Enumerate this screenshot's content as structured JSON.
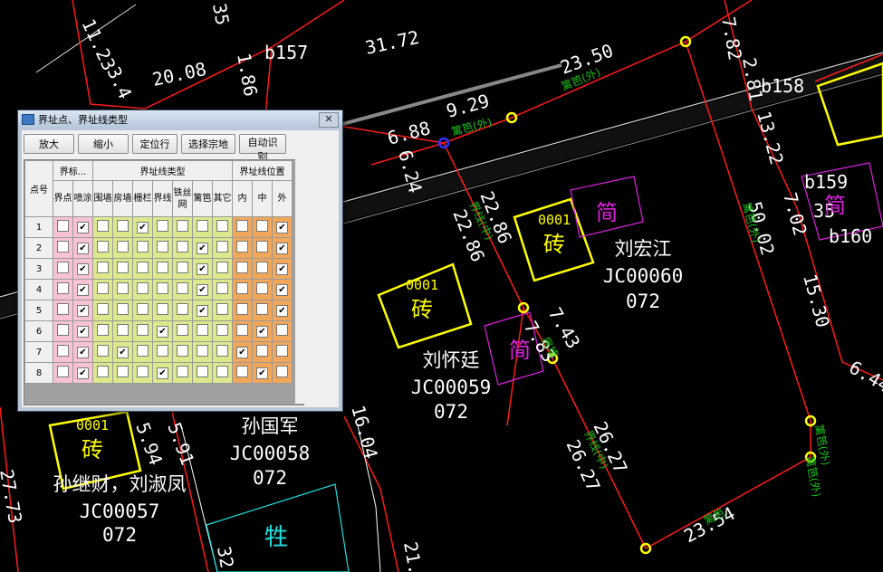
{
  "dialog": {
    "title": "界址点、界址线类型",
    "close_glyph": "✕",
    "toolbar": {
      "zoom_in": "放大",
      "zoom_out": "缩小",
      "locate_row": "定位行",
      "select_parcel": "选择宗地",
      "auto_identify": "自动识别"
    },
    "grid": {
      "point_no_header": "点号",
      "group_marker": "界标...",
      "group_line_type": "界址线类型",
      "group_line_pos": "界址线位置",
      "cols": [
        "界点",
        "喷涂",
        "围墙",
        "房墙",
        "栅栏",
        "界线",
        "铁丝网",
        "篱笆",
        "其它",
        "内",
        "中",
        "外"
      ],
      "col_colors": [
        "pink",
        "pink",
        "lime",
        "lime",
        "lime",
        "lime",
        "lime",
        "lime",
        "lime",
        "orng",
        "orng",
        "orng"
      ],
      "rows": [
        {
          "no": "1",
          "checks": [
            0,
            1,
            0,
            0,
            1,
            0,
            0,
            0,
            0,
            0,
            0,
            1
          ]
        },
        {
          "no": "2",
          "checks": [
            0,
            1,
            0,
            0,
            0,
            0,
            0,
            1,
            0,
            0,
            0,
            1
          ]
        },
        {
          "no": "3",
          "checks": [
            0,
            1,
            0,
            0,
            0,
            0,
            0,
            1,
            0,
            0,
            0,
            1
          ]
        },
        {
          "no": "4",
          "checks": [
            0,
            1,
            0,
            0,
            0,
            0,
            0,
            1,
            0,
            0,
            0,
            1
          ]
        },
        {
          "no": "5",
          "checks": [
            0,
            1,
            0,
            0,
            0,
            0,
            0,
            1,
            0,
            0,
            0,
            1
          ]
        },
        {
          "no": "6",
          "checks": [
            0,
            1,
            0,
            0,
            0,
            1,
            0,
            0,
            0,
            0,
            1,
            0
          ]
        },
        {
          "no": "7",
          "checks": [
            0,
            1,
            0,
            1,
            0,
            0,
            0,
            0,
            0,
            1,
            0,
            0
          ]
        },
        {
          "no": "8",
          "checks": [
            0,
            1,
            0,
            0,
            0,
            1,
            0,
            0,
            0,
            0,
            1,
            0
          ]
        }
      ],
      "check_glyph": "✔"
    }
  },
  "cad": {
    "dims": [
      "31.72",
      "20.08",
      "11.23",
      "3.4",
      "1.86",
      "35",
      "23.50",
      "9.29",
      "6.88",
      "6.24",
      "22.86",
      "22.86",
      "7.43",
      "7.83",
      "26.27",
      "26.27",
      "23.54",
      "7.82",
      "2.81",
      "13.22",
      "50.02",
      "7.02",
      "15.30",
      "6.44",
      "16.04",
      "5.94",
      "5.91",
      "27.73",
      "32",
      "21."
    ],
    "point_labels": [
      "b157",
      "b158",
      "b159",
      "35",
      "b160"
    ],
    "parcels": [
      {
        "owner": "刘宏江",
        "code": "JC00060",
        "sub": "072"
      },
      {
        "owner": "刘怀廷",
        "code": "JC00059",
        "sub": "072"
      },
      {
        "owner": "孙国军",
        "code": "JC00058",
        "sub": "072"
      },
      {
        "owner": "孙继财，刘淑凤",
        "code": "JC00057",
        "sub": "072"
      }
    ],
    "bricks": [
      {
        "num": "0001",
        "label": "砖"
      },
      {
        "num": "0001",
        "label": "砖"
      },
      {
        "num": "0001",
        "label": "砖"
      }
    ],
    "simple_labels": [
      "简",
      "简",
      "简"
    ],
    "cattle_label": "牲",
    "line_notes": [
      "篱笆(外)",
      "篱笆(外)",
      "篱笆(外)",
      "篱笆(外)",
      "界线(中)",
      "界线(中)",
      "房墙",
      "篱笆",
      "篱笆(外)"
    ],
    "colors": {
      "boundary": "#ff1a1a",
      "vertex": "#ffff00",
      "text": "#ffffff",
      "blue": "#2020ff",
      "green": "#18c018",
      "magenta": "#e020e0",
      "cyan": "#20e0e0"
    }
  }
}
